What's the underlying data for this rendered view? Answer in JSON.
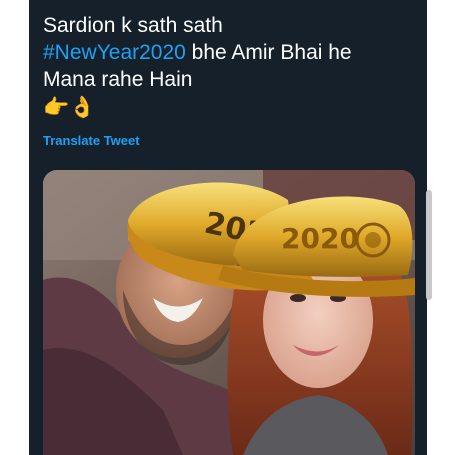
{
  "tweet": {
    "line1": "Sardion k sath sath",
    "hashtag": "#NewYear2020",
    "line2_rest": " bhe Amir Bhai he",
    "line3": "Mana rahe Hain",
    "emoji_point": "👉",
    "emoji_ok": "👌",
    "translate_label": "Translate Tweet"
  },
  "media": {
    "hat_text_left": "2020",
    "hat_text_right": "2020"
  }
}
